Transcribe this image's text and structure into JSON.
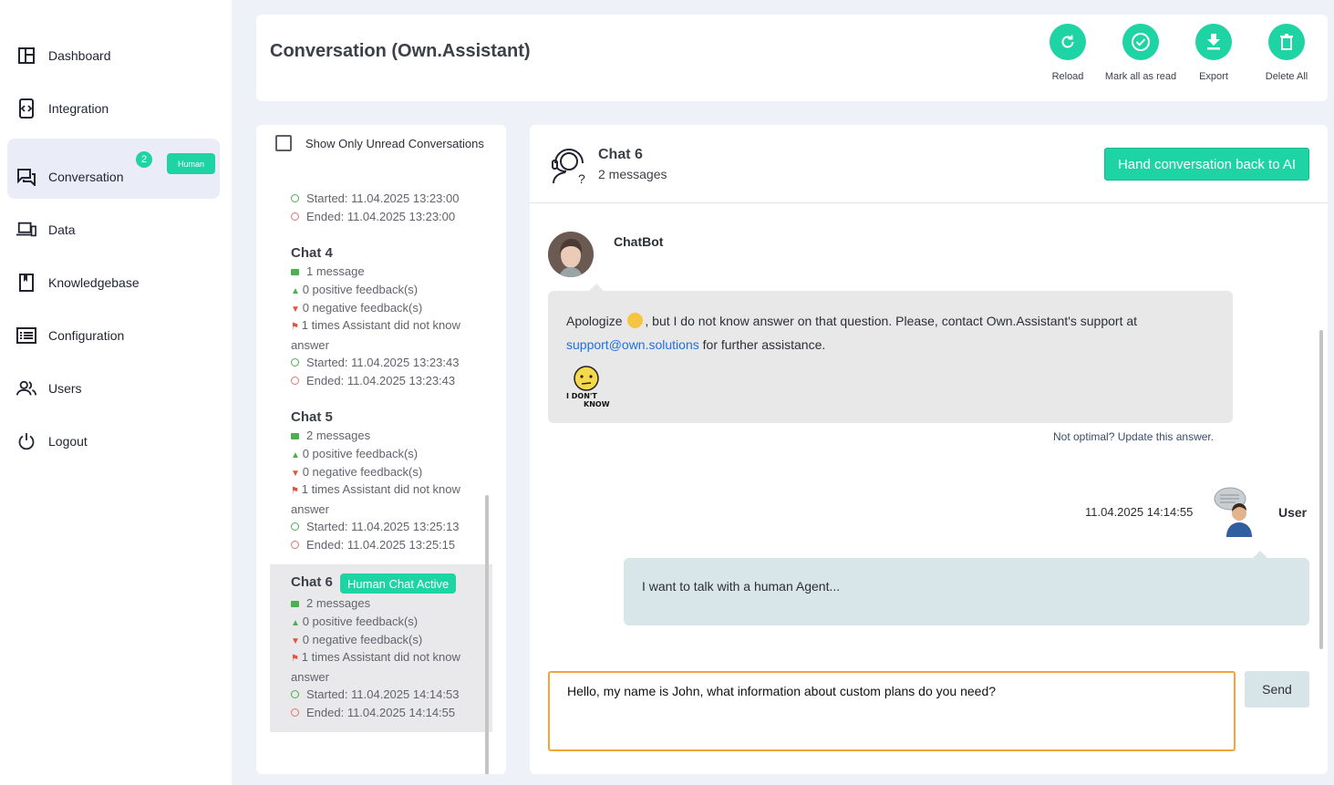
{
  "sidebar": {
    "items": [
      {
        "label": "Dashboard",
        "icon": "dashboard-icon"
      },
      {
        "label": "Integration",
        "icon": "integration-icon"
      },
      {
        "label": "Conversation",
        "icon": "conversation-icon",
        "badge": "2",
        "tag": "Human",
        "active": true
      },
      {
        "label": "Data",
        "icon": "devices-icon"
      },
      {
        "label": "Knowledgebase",
        "icon": "book-icon"
      },
      {
        "label": "Configuration",
        "icon": "list-icon"
      },
      {
        "label": "Users",
        "icon": "users-icon"
      },
      {
        "label": "Logout",
        "icon": "power-icon"
      }
    ]
  },
  "header": {
    "title": "Conversation (Own.Assistant)",
    "actions": [
      {
        "label": "Reload",
        "icon": "reload-icon"
      },
      {
        "label": "Mark all as read",
        "icon": "check-circle-icon"
      },
      {
        "label": "Export",
        "icon": "download-icon"
      },
      {
        "label": "Delete All",
        "icon": "trash-icon"
      }
    ]
  },
  "list": {
    "unread_label": "Show Only Unread Conversations",
    "partial": {
      "started": "Started: 11.04.2025 13:23:00",
      "ended": "Ended: 11.04.2025 13:23:00"
    },
    "chats": [
      {
        "title": "Chat 4",
        "messages": "1 message",
        "positive": "0 positive feedback(s)",
        "negative": "0 negative feedback(s)",
        "unknown": "1 times Assistant did not know answer",
        "started": "Started: 11.04.2025 13:23:43",
        "ended": "Ended: 11.04.2025 13:23:43"
      },
      {
        "title": "Chat 5",
        "messages": "2 messages",
        "positive": "0 positive feedback(s)",
        "negative": "0 negative feedback(s)",
        "unknown": "1 times Assistant did not know answer",
        "started": "Started: 11.04.2025 13:25:13",
        "ended": "Ended: 11.04.2025 13:25:15"
      },
      {
        "title": "Chat 6",
        "tag": "Human Chat Active",
        "messages": "2 messages",
        "positive": "0 positive feedback(s)",
        "negative": "0 negative feedback(s)",
        "unknown": "1 times Assistant did not know answer",
        "started": "Started: 11.04.2025 14:14:53",
        "ended": "Ended: 11.04.2025 14:14:55"
      }
    ]
  },
  "chat": {
    "name": "Chat 6",
    "count": "2 messages",
    "handback_label": "Hand conversation back to AI",
    "bot_name": "ChatBot",
    "bot_text_1": "Apologize ",
    "bot_text_2": ", but I do not know answer on that question. Please, contact Own.Assistant's support at ",
    "bot_link": "support@own.solutions",
    "bot_text_3": " for further assistance.",
    "idk_text_1": "I DON'T",
    "idk_text_2": "KNOW",
    "update_link": "Not optimal? Update this answer.",
    "user_time": "11.04.2025 14:14:55",
    "user_name": "User",
    "user_text": "I want to talk with a human Agent...",
    "reply_value": "Hello, my name is John, what information about custom plans do you need?",
    "send_label": "Send"
  },
  "colors": {
    "accent": "#1ed3a4",
    "input_border": "#f0a43a",
    "user_bubble": "#d9e6e9",
    "bot_bubble": "#e8e8e8"
  }
}
